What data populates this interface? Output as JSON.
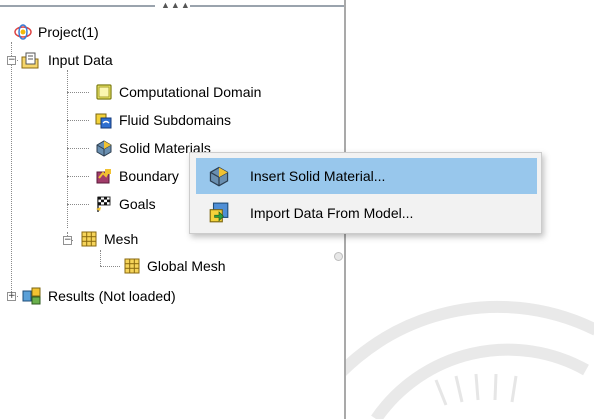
{
  "tree": {
    "root": {
      "label": "Project(1)",
      "icon": "project-icon"
    },
    "input_data": {
      "label": "Input Data",
      "icon": "folder-data-icon"
    },
    "computational_domain": {
      "label": "Computational Domain",
      "icon": "domain-box-icon"
    },
    "fluid_subdomains": {
      "label": "Fluid Subdomains",
      "icon": "fluid-subdomain-icon"
    },
    "solid_materials": {
      "label": "Solid Materials",
      "icon": "solid-material-icon"
    },
    "boundary": {
      "label": "Boundary",
      "icon": "boundary-icon"
    },
    "goals": {
      "label": "Goals",
      "icon": "goals-flag-icon"
    },
    "mesh": {
      "label": "Mesh",
      "icon": "mesh-icon"
    },
    "global_mesh": {
      "label": "Global Mesh",
      "icon": "mesh-icon"
    },
    "results": {
      "label": "Results (Not loaded)",
      "icon": "results-icon"
    }
  },
  "context_menu": {
    "items": [
      {
        "label": "Insert Solid Material...",
        "icon": "solid-material-icon",
        "highlighted": true
      },
      {
        "label": "Import Data From Model...",
        "icon": "import-data-icon",
        "highlighted": false
      }
    ]
  },
  "grip": {
    "dots": "▲▲▲"
  },
  "colors": {
    "menu_highlight": "#98c7ec",
    "tree_lines": "#8a8a8a",
    "panel_border": "#a9a9a9"
  }
}
